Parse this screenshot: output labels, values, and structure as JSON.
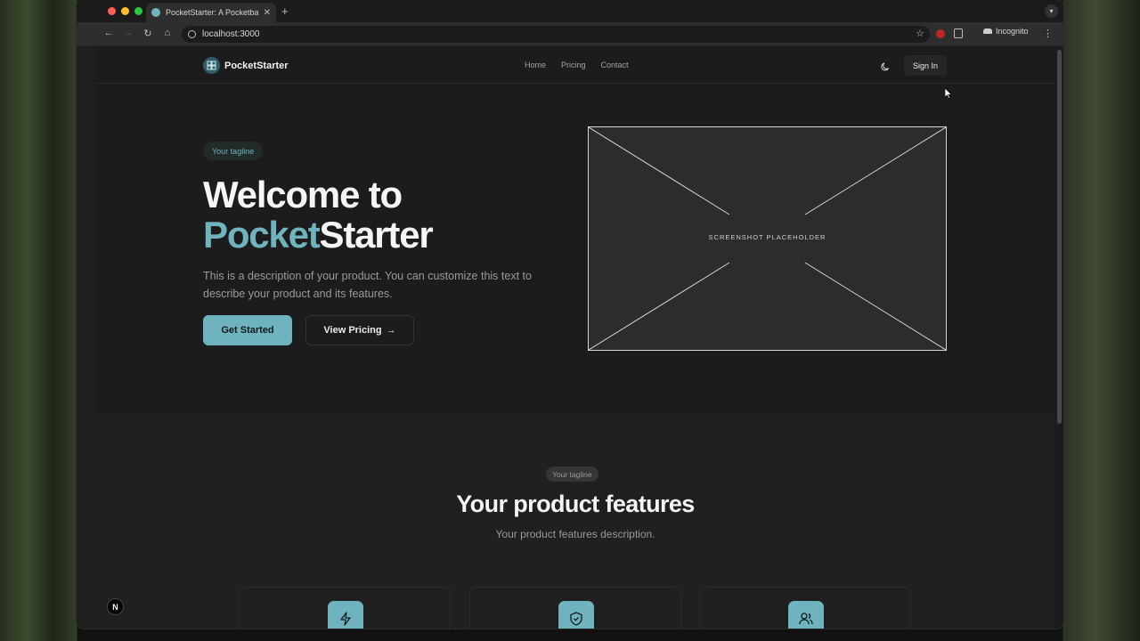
{
  "browser": {
    "tab_title": "PocketStarter: A Pocketbase",
    "tab_close": "✕",
    "new_tab": "+",
    "url": "localhost:3000",
    "incognito_label": "Incognito"
  },
  "site": {
    "brand": "PocketStarter",
    "nav": [
      "Home",
      "Pricing",
      "Contact"
    ],
    "sign_in": "Sign In"
  },
  "hero": {
    "tagline": "Your tagline",
    "title_line1": "Welcome to",
    "title_accent": "Pocket",
    "title_rest": "Starter",
    "description": "This is a description of your product. You can customize this text to describe your product and its features.",
    "primary_button": "Get Started",
    "secondary_button": "View Pricing",
    "placeholder_label": "SCREENSHOT PLACEHOLDER"
  },
  "features": {
    "tagline": "Your tagline",
    "title": "Your product features",
    "description": "Your product features description.",
    "cards": [
      {
        "icon": "lightning-icon"
      },
      {
        "icon": "shield-check-icon"
      },
      {
        "icon": "users-icon"
      }
    ]
  },
  "nextjs_badge": "N",
  "colors": {
    "accent": "#6fb3bf",
    "background": "#1c1c1c",
    "text": "#f5f5f5"
  }
}
